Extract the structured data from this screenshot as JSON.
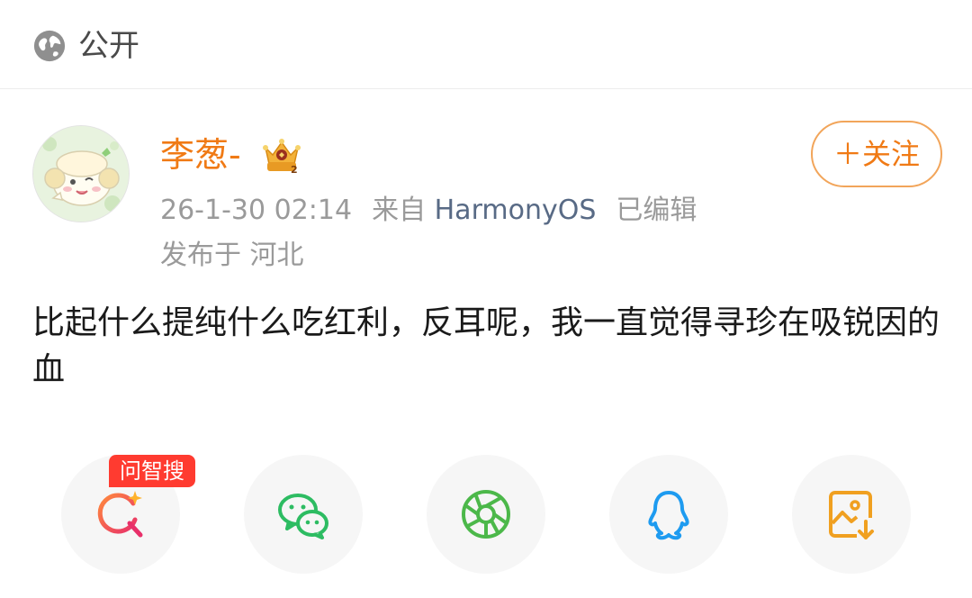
{
  "visibility": {
    "label": "公开",
    "icon": "globe-icon"
  },
  "author": {
    "name": "李葱-",
    "avatar_icon": "avatar-image",
    "badge_icon": "crown-badge-icon",
    "follow_label": "＋关注"
  },
  "meta": {
    "time": "26-1-30 02:14",
    "source_prefix": "来自",
    "source": "HarmonyOS",
    "edited": "已编辑",
    "location": "发布于 河北"
  },
  "post": {
    "text": "比起什么提纯什么吃红利，反耳呢，我一直觉得寻珍在吸锐因的血"
  },
  "share": {
    "ai_tag": "问智搜",
    "items": [
      {
        "icon": "ai-search-icon"
      },
      {
        "icon": "wechat-icon"
      },
      {
        "icon": "moments-icon"
      },
      {
        "icon": "qq-icon"
      },
      {
        "icon": "save-image-icon"
      }
    ]
  },
  "colors": {
    "accent": "#f07a15",
    "source_link": "#586a85",
    "tag_red": "#ff3b30"
  }
}
